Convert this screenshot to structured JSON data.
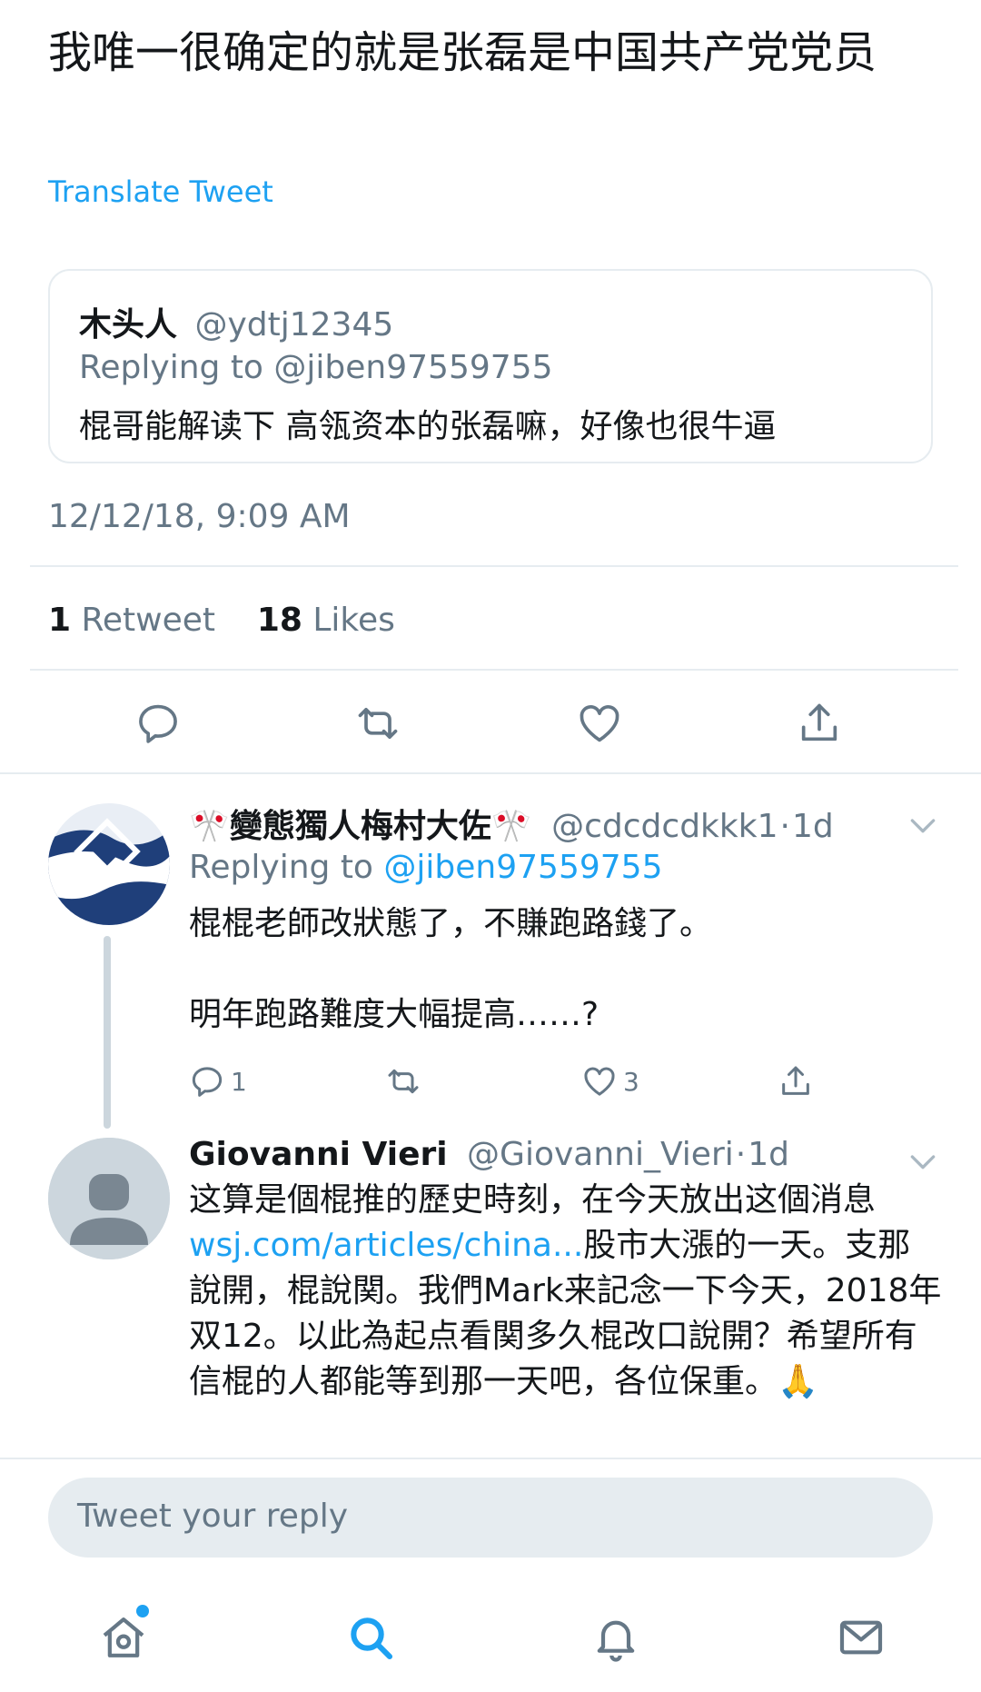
{
  "tweet": {
    "text": "我唯一很确定的就是张磊是中国共产党党员",
    "translate_label": "Translate Tweet",
    "timestamp": "12/12/18, 9:09 AM"
  },
  "quoted_tweet": {
    "name": "木头人",
    "handle": "@ydtj12345",
    "replying_to_label": "Replying to",
    "replying_to_handle": "@jiben97559755",
    "body": "棍哥能解读下 高瓴资本的张磊嘛，好像也很牛逼"
  },
  "stats": {
    "retweet_count": "1",
    "retweet_label": "Retweet",
    "likes_count": "18",
    "likes_label": "Likes"
  },
  "replies": [
    {
      "name": "🎌變態獨人梅村大佐🎌",
      "handle": "@cdcdcdkkk1",
      "separator": "·",
      "age": "1d",
      "replying_to_label": "Replying to",
      "replying_to_handle": "@jiben97559755",
      "text_line1": "棍棍老師改狀態了，不賺跑路錢了。",
      "text_line2": "明年跑路難度大幅提高……?",
      "reply_count": "1",
      "like_count": "3"
    },
    {
      "name": "Giovanni Vieri",
      "handle": "@Giovanni_Vieri",
      "separator": "·",
      "age": "1d",
      "text_before_link": "这算是個棍推的歷史時刻，在今天放出这個消息",
      "link_text": "wsj.com/articles/china...",
      "text_after_link": "股市大漲的一天。支那說開，棍說関。我們Mark来記念一下今天，2018年双12。以此為起点看関多久棍改口說開？希望所有信棍的人都能等到那一天吧，各位保重。🙏"
    }
  ],
  "composer": {
    "placeholder": "Tweet your reply"
  },
  "colors": {
    "accent": "#1da1f2",
    "secondary_text": "#657786",
    "divider": "#e6ecf0"
  },
  "icons": {
    "actions": [
      "reply-icon",
      "retweet-icon",
      "like-icon",
      "share-icon"
    ],
    "tabs": [
      "home-icon",
      "search-icon",
      "notifications-icon",
      "messages-icon"
    ]
  }
}
